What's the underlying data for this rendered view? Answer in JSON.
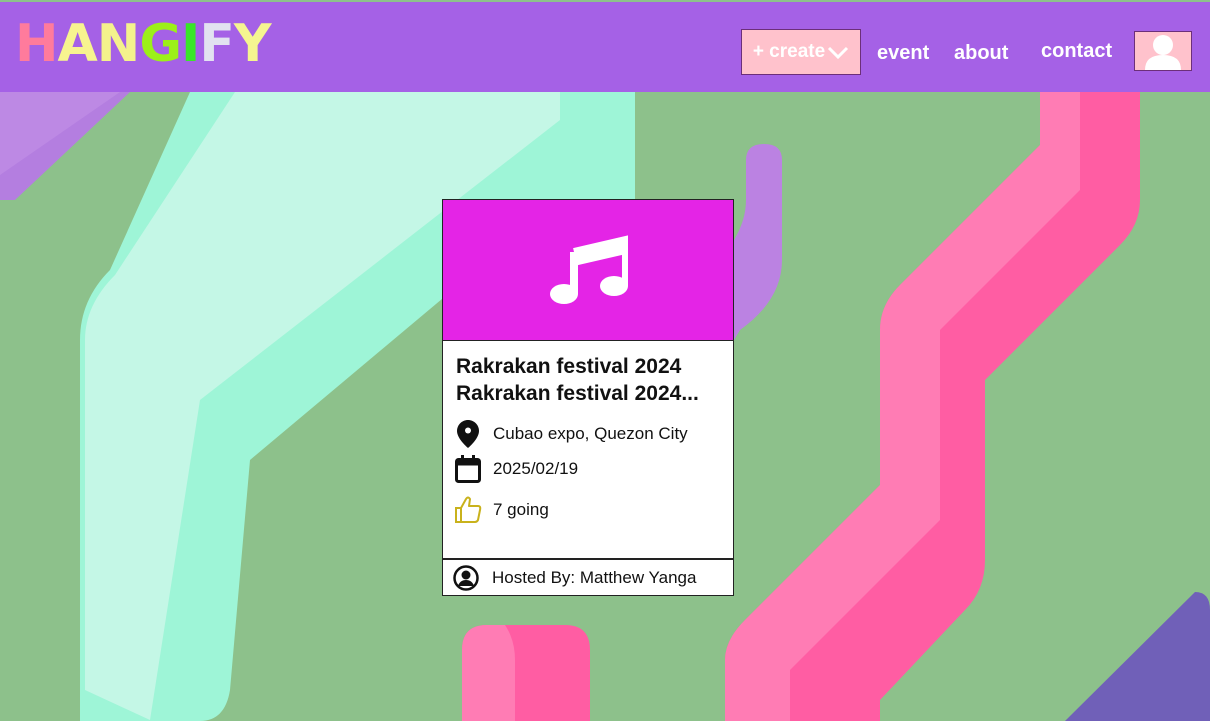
{
  "brand": {
    "letters": [
      {
        "ch": "H",
        "color": "#ff7b9c"
      },
      {
        "ch": "A",
        "color": "#f7f48f"
      },
      {
        "ch": "N",
        "color": "#f4f28c"
      },
      {
        "ch": "G",
        "color": "#9cf019"
      },
      {
        "ch": "I",
        "color": "#39e629"
      },
      {
        "ch": "F",
        "color": "#e2e2f0"
      },
      {
        "ch": "Y",
        "color": "#f5f590"
      }
    ]
  },
  "nav": {
    "create_label": "+ create",
    "event_label": "event",
    "about_label": "about",
    "contact_label": "contact"
  },
  "event_card": {
    "title_line1": "Rakrakan festival 2024",
    "title_line2": "Rakrakan festival 2024...",
    "location": "Cubao expo, Quezon City",
    "date": "2025/02/19",
    "going": "7 going",
    "host": "Hosted By: Matthew Yanga",
    "icon": "music-note-icon"
  },
  "colors": {
    "header": "#a561e6",
    "hero": "#e424e6",
    "background": "#8dc18b",
    "button": "#ffc2cc",
    "like": "#c9b21c"
  }
}
